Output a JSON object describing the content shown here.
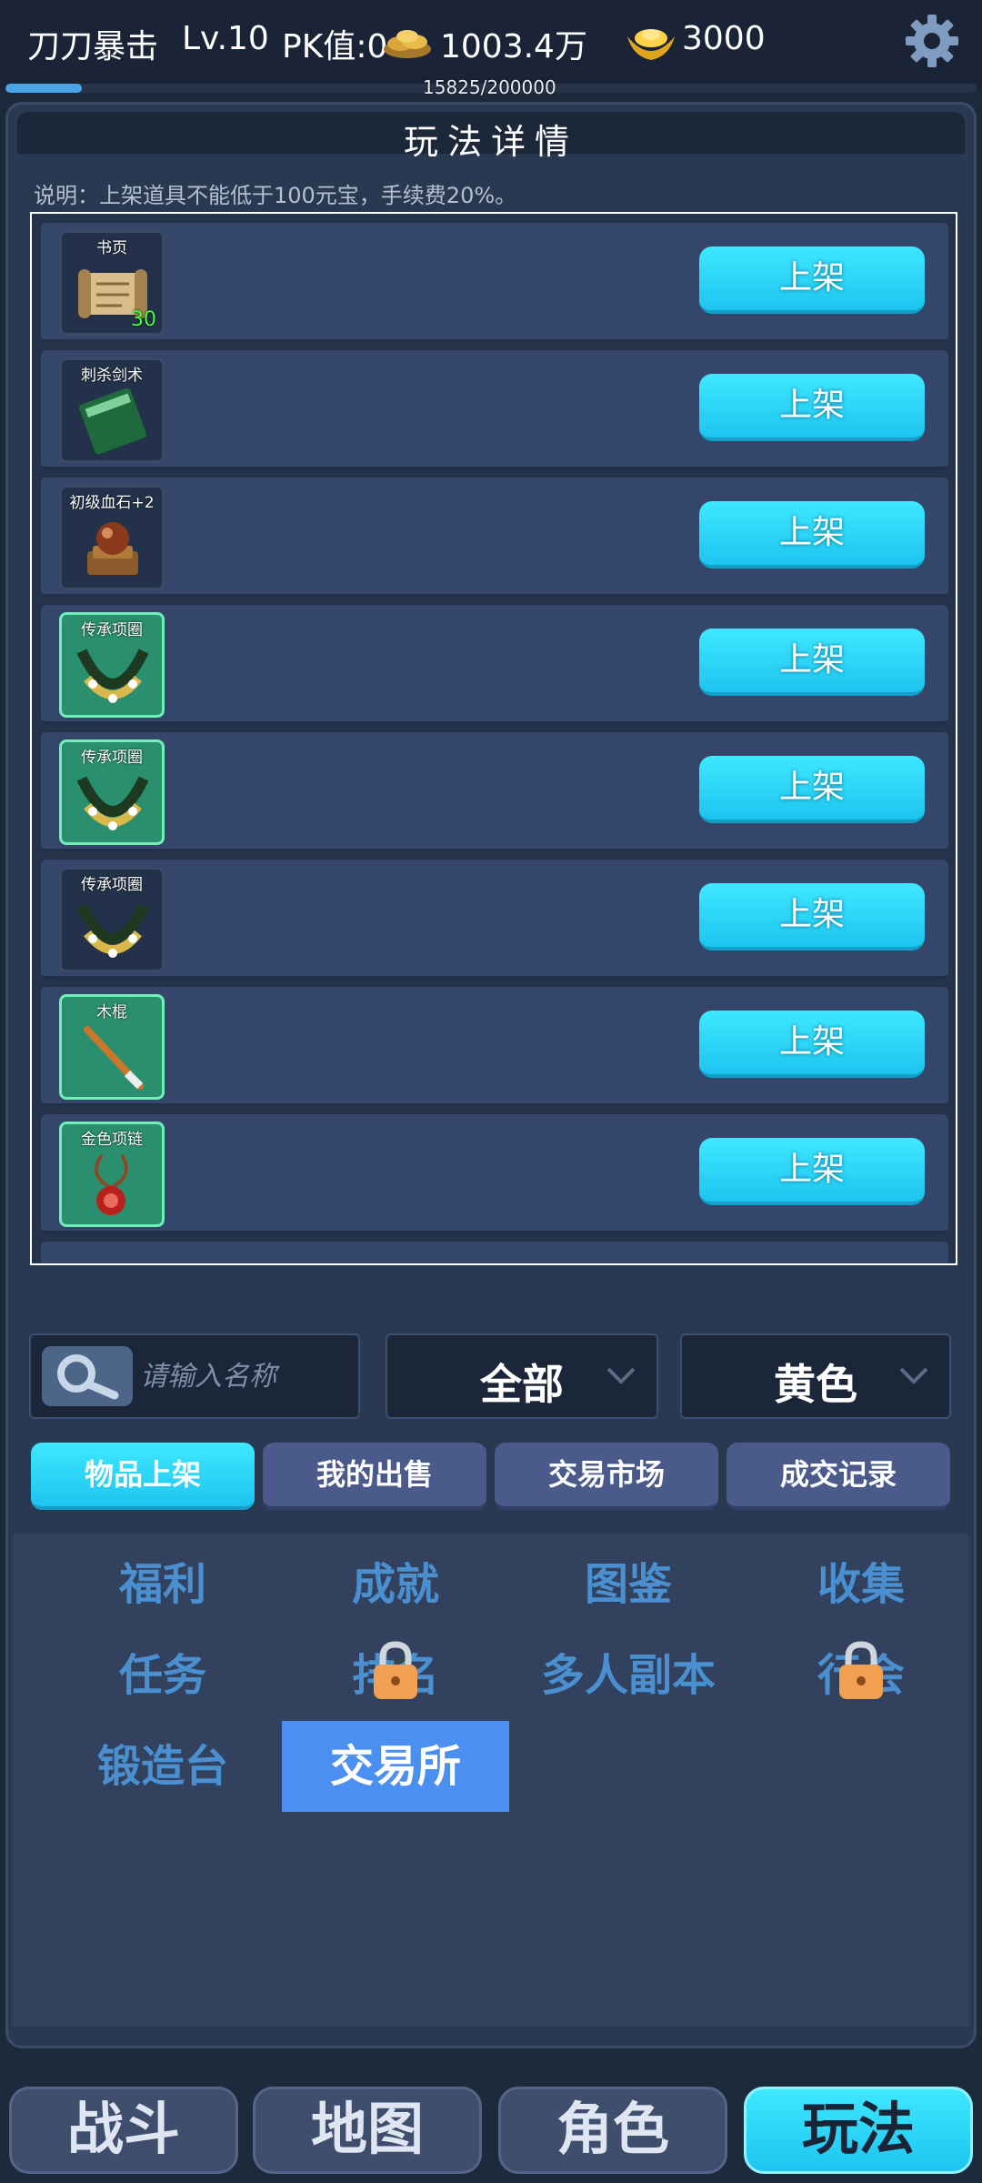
{
  "player": {
    "name": "刀刀暴击",
    "level": "Lv.10",
    "pk": "PK值:0",
    "coins": "1003.4万",
    "ingots": "3000",
    "exp_text": "15825/200000",
    "exp_progress": 0.079
  },
  "panel": {
    "title": "玩法详情",
    "notice": "说明：上架道具不能低于100元宝，手续费20%。"
  },
  "items": [
    {
      "name": "书页",
      "count": "30",
      "quality": "normal",
      "icon": "scroll-icon",
      "button": "上架"
    },
    {
      "name": "刺杀剑术",
      "count": "",
      "quality": "normal",
      "icon": "skill-book-icon",
      "button": "上架"
    },
    {
      "name": "初级血石+2",
      "count": "",
      "quality": "normal",
      "icon": "blood-stone-icon",
      "button": "上架"
    },
    {
      "name": "传承项圈",
      "count": "",
      "quality": "green",
      "icon": "necklace-icon",
      "button": "上架"
    },
    {
      "name": "传承项圈",
      "count": "",
      "quality": "green",
      "icon": "necklace-icon",
      "button": "上架"
    },
    {
      "name": "传承项圈",
      "count": "",
      "quality": "normal",
      "icon": "necklace-icon",
      "button": "上架"
    },
    {
      "name": "木棍",
      "count": "",
      "quality": "green",
      "icon": "wooden-stick-icon",
      "button": "上架"
    },
    {
      "name": "金色项链",
      "count": "",
      "quality": "green",
      "icon": "pendant-icon",
      "button": "上架"
    }
  ],
  "filters": {
    "search_placeholder": "请输入名称",
    "category": "全部",
    "color": "黄色"
  },
  "tabs": [
    "物品上架",
    "我的出售",
    "交易市场",
    "成交记录"
  ],
  "active_tab": 0,
  "features": [
    {
      "label": "福利",
      "locked": false
    },
    {
      "label": "成就",
      "locked": false
    },
    {
      "label": "图鉴",
      "locked": false
    },
    {
      "label": "收集",
      "locked": false
    },
    {
      "label": "任务",
      "locked": false
    },
    {
      "label": "排名",
      "locked": true
    },
    {
      "label": "多人副本",
      "locked": false
    },
    {
      "label": "行会",
      "locked": true
    },
    {
      "label": "锻造台",
      "locked": false
    },
    {
      "label": "交易所",
      "locked": false,
      "active": true
    }
  ],
  "bottom_nav": [
    "战斗",
    "地图",
    "角色",
    "玩法"
  ],
  "active_nav": 3,
  "colors": {
    "accent": "#1ec4f0",
    "panel": "#2a3952",
    "feature_text": "#4a8fd0",
    "feature_active": "#4b8ff0"
  }
}
